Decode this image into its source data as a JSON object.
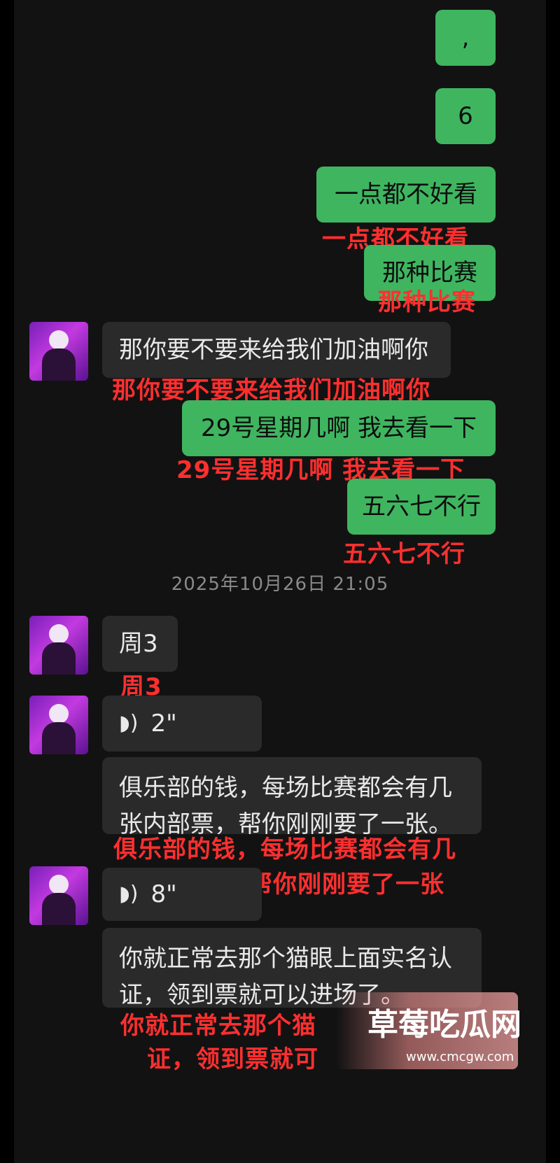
{
  "messages": {
    "m1": ",",
    "m2": "6",
    "m3": "一点都不好看",
    "m3_note": "一点都不好看",
    "m4": "那种比赛",
    "m4_note": "那种比赛",
    "m5": "那你要不要来给我们加油啊你",
    "m5_note": "那你要不要来给我们加油啊你",
    "m6": "29号星期几啊 我去看一下",
    "m6_note": "29号星期几啊 我去看一下",
    "m7": "五六七不行",
    "m7_note": "五六七不行",
    "timestamp": "2025年10月26日 21:05",
    "m8": "周3",
    "m8_note": "周3",
    "voice1_duration": "2\"",
    "m9": "俱乐部的钱，每场比赛都会有几张内部票，帮你刚刚要了一张。",
    "m9_note_line1": "俱乐部的钱，每场比赛都会有几",
    "m9_note_line2": "张内部票，帮你刚刚要了一张",
    "voice2_duration": "8\"",
    "m10": "你就正常去那个猫眼上面实名认证，领到票就可以进场了。",
    "m10_note_line1": "你就正常去那个猫",
    "m10_note_line2": "证，领到票就可"
  },
  "icons": {
    "voice": "voice-wave-icon",
    "avatar": "purple-avatar"
  },
  "watermark": {
    "title": "草莓吃瓜网",
    "url": "www.cmcgw.com"
  },
  "colors": {
    "my_bubble": "#3fb560",
    "their_bubble": "#2a2a2a",
    "annotation": "#ff2f2f"
  }
}
